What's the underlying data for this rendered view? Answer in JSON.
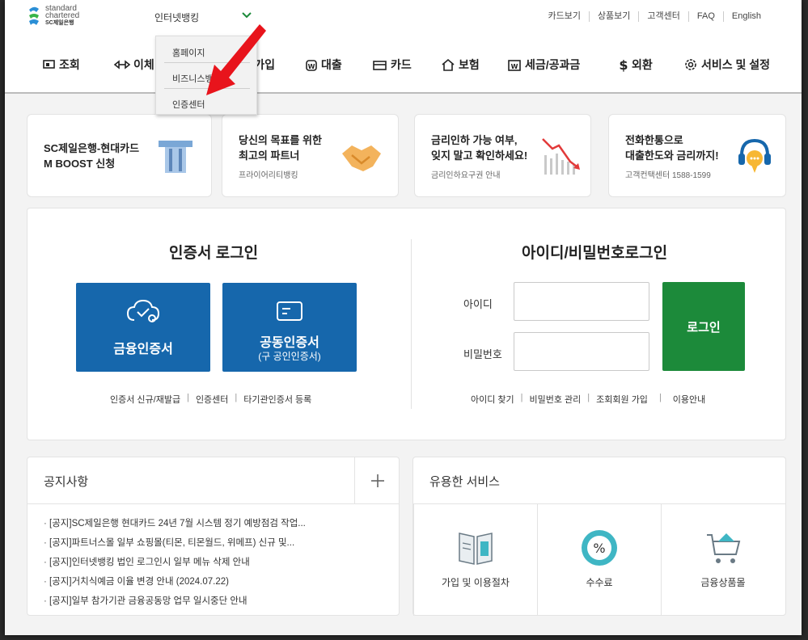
{
  "brand": {
    "line1": "standard",
    "line2": "chartered",
    "line3": "SC제일은행",
    "colors": {
      "green": "#1c8a3a",
      "blue": "#1667ac"
    }
  },
  "header": {
    "site_select": "인터넷뱅킹",
    "utility_links": [
      "카드보기",
      "상품보기",
      "고객센터",
      "FAQ",
      "English"
    ]
  },
  "dropdown": {
    "items": [
      "홈페이지",
      "비즈니스뱅",
      "인증센터"
    ]
  },
  "gnb": {
    "items": [
      "조회",
      "이체",
      "상품가입",
      "대출",
      "카드",
      "보험",
      "세금/공과금",
      "외환",
      "서비스 및 설정"
    ]
  },
  "banners": [
    {
      "title1": "SC제일은행-현대카드",
      "title2": "M BOOST 신청",
      "sub": ""
    },
    {
      "title1": "당신의 목표를 위한",
      "title2": "최고의 파트너",
      "sub": "프라이어리티뱅킹"
    },
    {
      "title1": "금리인하 가능 여부,",
      "title2": "잊지 말고 확인하세요!",
      "sub": "금리인하요구권 안내"
    },
    {
      "title1": "전화한통으로",
      "title2": "대출한도와 금리까지!",
      "sub": "고객컨택센터 1588-1599"
    }
  ],
  "cert_login": {
    "heading": "인증서 로그인",
    "financial_cert": "금융인증서",
    "joint_cert": "공동인증서",
    "joint_cert_sub": "(구 공인인증서)",
    "links": [
      "인증서 신규/재발급",
      "인증센터",
      "타기관인증서 등록"
    ]
  },
  "id_login": {
    "heading": "아이디/비밀번호로그인",
    "id_label": "아이디",
    "pw_label": "비밀번호",
    "id_value": "",
    "pw_value": "",
    "login_button": "로그인",
    "links": [
      "아이디 찾기",
      "비밀번호 관리",
      "조회회원 가입",
      "이용안내"
    ]
  },
  "notice": {
    "title": "공지사항",
    "items": [
      "[공지]SC제일은행 현대카드 24년 7월 시스템 정기 예방점검 작업...",
      "[공지]파트너스몰 일부 쇼핑몰(티몬, 티몬월드, 위메프) 신규 및...",
      "[공지]인터넷뱅킹 법인 로그인시 일부 메뉴 삭제 안내",
      "[공지]거치식예금 이율 변경 안내 (2024.07.22)",
      "[공지]일부 참가기관 금융공동망 업무 일시중단 안내"
    ]
  },
  "services": {
    "title": "유용한 서비스",
    "items": [
      "가입 및 이용절차",
      "수수료",
      "금융상품몰"
    ]
  }
}
